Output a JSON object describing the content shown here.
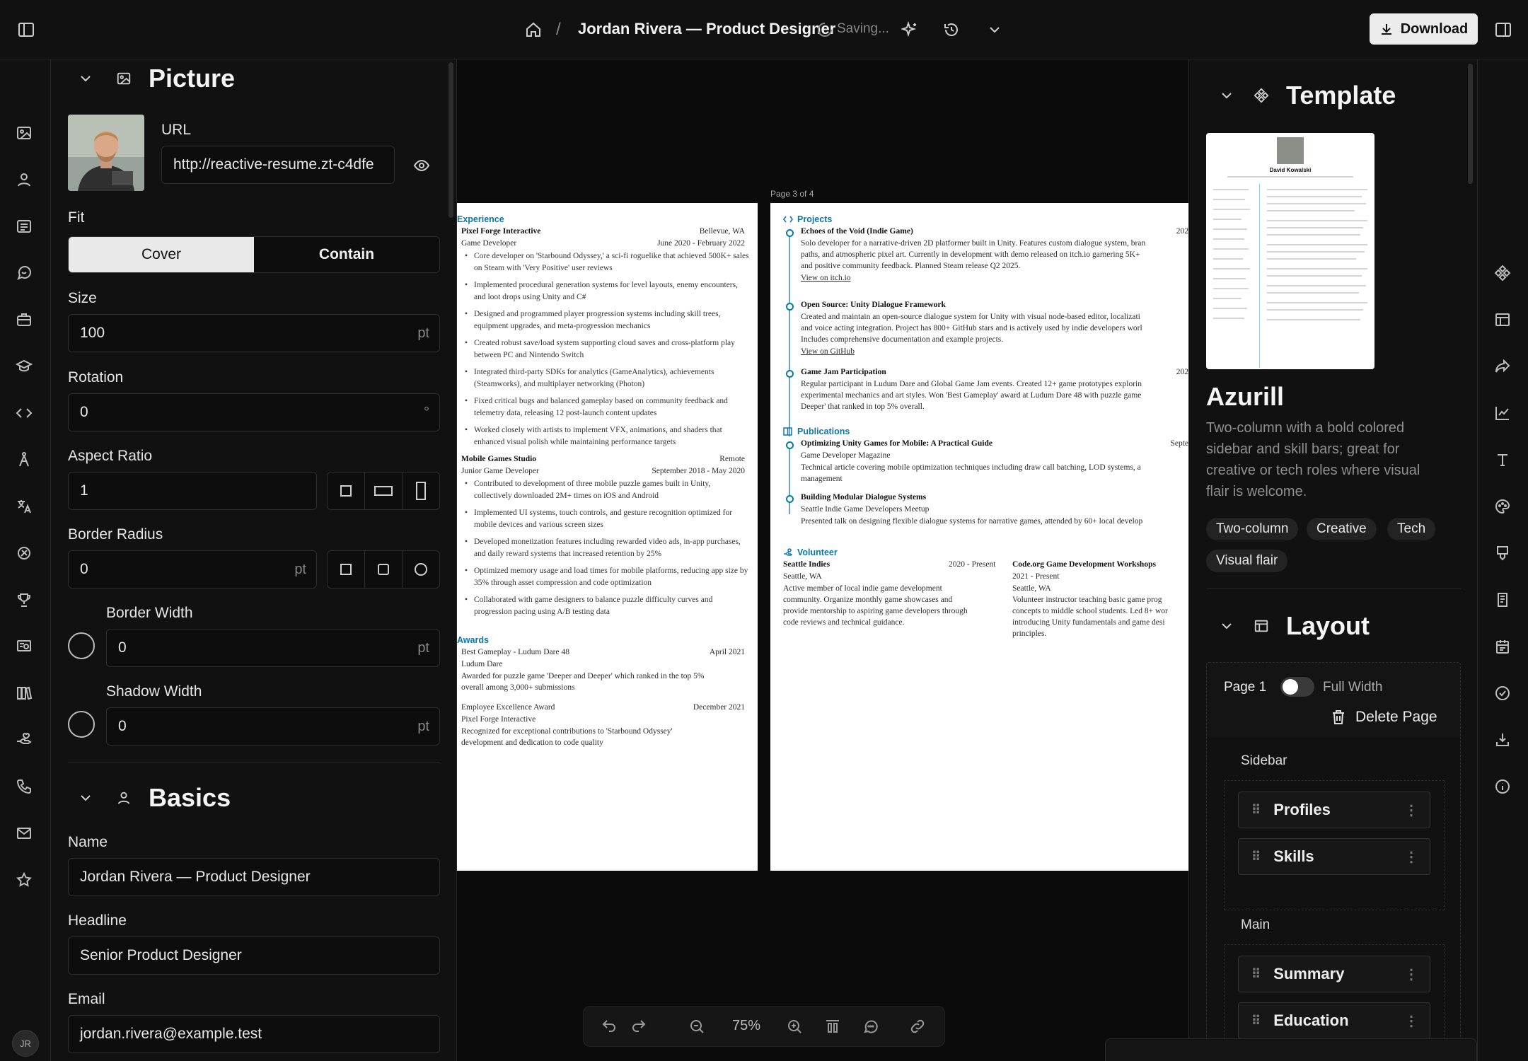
{
  "topbar": {
    "title": "Jordan Rivera — Product Designer",
    "separator": "/",
    "status": "Saving...",
    "download_label": "Download"
  },
  "picture": {
    "heading": "Picture",
    "url_label": "URL",
    "url_value": "http://reactive-resume.zt-c4dfe",
    "fit_label": "Fit",
    "fit_options": [
      "Cover",
      "Contain"
    ],
    "fit_selected": "Cover",
    "size_label": "Size",
    "size_value": "100",
    "size_unit": "pt",
    "rotation_label": "Rotation",
    "rotation_value": "0",
    "rotation_unit": "°",
    "aspect_label": "Aspect Ratio",
    "aspect_value": "1",
    "radius_label": "Border Radius",
    "radius_value": "0",
    "radius_unit": "pt",
    "border_width_label": "Border Width",
    "border_width_value": "0",
    "border_width_unit": "pt",
    "shadow_label": "Shadow Width",
    "shadow_value": "0",
    "shadow_unit": "pt"
  },
  "basics": {
    "heading": "Basics",
    "name_label": "Name",
    "name_value": "Jordan Rivera — Product Designer",
    "headline_label": "Headline",
    "headline_value": "Senior Product Designer",
    "email_label": "Email",
    "email_value": "jordan.rivera@example.test"
  },
  "user": {
    "initials": "JR"
  },
  "page_indicator": "Page 3 of 4",
  "resume_left": {
    "experience_heading": "Experience",
    "job1": {
      "company": "Pixel Forge Interactive",
      "location": "Bellevue, WA",
      "role": "Game Developer",
      "dates": "June 2020 - February 2022",
      "bullets": [
        "Core developer on 'Starbound Odyssey,' a sci-fi roguelike that achieved 500K+ sales on Steam with 'Very Positive' user reviews",
        "Implemented procedural generation systems for level layouts, enemy encounters, and loot drops using Unity and C#",
        "Designed and programmed player progression systems including skill trees, equipment upgrades, and meta-progression mechanics",
        "Created robust save/load system supporting cloud saves and cross-platform play between PC and Nintendo Switch",
        "Integrated third-party SDKs for analytics (GameAnalytics), achievements (Steamworks), and multiplayer networking (Photon)",
        "Fixed critical bugs and balanced gameplay based on community feedback and telemetry data, releasing 12 post-launch content updates",
        "Worked closely with artists to implement VFX, animations, and shaders that enhanced visual polish while maintaining performance targets"
      ]
    },
    "job2": {
      "company": "Mobile Games Studio",
      "location": "Remote",
      "role": "Junior Game Developer",
      "dates": "September 2018 - May 2020",
      "bullets": [
        "Contributed to development of three mobile puzzle games built in Unity, collectively downloaded 2M+ times on iOS and Android",
        "Implemented UI systems, touch controls, and gesture recognition optimized for mobile devices and various screen sizes",
        "Developed monetization features including rewarded video ads, in-app purchases, and daily reward systems that increased retention by 25%",
        "Optimized memory usage and load times for mobile platforms, reducing app size by 35% through asset compression and code optimization",
        "Collaborated with game designers to balance puzzle difficulty curves and progression pacing using A/B testing data"
      ]
    },
    "awards_heading": "Awards",
    "award1": {
      "title": "Best Gameplay - Ludum Dare 48",
      "date": "April 2021",
      "issuer": "Ludum Dare",
      "desc1": "Awarded for puzzle game 'Deeper and Deeper' which ranked in the top 5%",
      "desc2": "overall among 3,000+ submissions"
    },
    "award2": {
      "title": "Employee Excellence Award",
      "date": "December 2021",
      "issuer": "Pixel Forge Interactive",
      "desc1": "Recognized for exceptional contributions to 'Starbound Odyssey'",
      "desc2": "development and dedication to code quality"
    }
  },
  "resume_right": {
    "projects_heading": "Projects",
    "p1": {
      "title": "Echoes of the Void (Indie Game)",
      "date": "202",
      "l1": "Solo developer for a narrative-driven 2D platformer built in Unity. Features custom dialogue system, bran",
      "l2": "paths, and atmospheric pixel art. Currently in development with demo released on itch.io garnering 5K+",
      "l3": "and positive community feedback. Planned Steam release Q2 2025.",
      "link": "View on itch.io"
    },
    "p2": {
      "title": "Open Source: Unity Dialogue Framework",
      "l1": "Created and maintain an open-source dialogue system for Unity with visual node-based editor, localizati",
      "l2": "and voice acting integration. Project has 800+ GitHub stars and is actively used by indie developers worl",
      "l3": "Includes comprehensive documentation and example projects.",
      "link": "View on GitHub"
    },
    "p3": {
      "title": "Game Jam Participation",
      "date": "202",
      "l1": "Regular participant in Ludum Dare and Global Game Jam events. Created 12+ game prototypes explorin",
      "l2": "experimental mechanics and art styles. Won 'Best Gameplay' award at Ludum Dare 48 with puzzle game",
      "l3": "Deeper' that ranked in top 5% overall."
    },
    "publications_heading": "Publications",
    "pub1": {
      "title": "Optimizing Unity Games for Mobile: A Practical Guide",
      "date": "Septe",
      "venue": "Game Developer Magazine",
      "l1": "Technical article covering mobile optimization techniques including draw call batching, LOD systems, a",
      "l2": "management"
    },
    "pub2": {
      "title": "Building Modular Dialogue Systems",
      "venue": "Seattle Indie Game Developers Meetup",
      "l1": "Presented talk on designing flexible dialogue systems for narrative games, attended by 60+ local develop"
    },
    "volunteer_heading": "Volunteer",
    "v1": {
      "org": "Seattle Indies",
      "dates": "2020 - Present",
      "loc": "Seattle, WA",
      "l1": "Active member of local indie game development",
      "l2": "community. Organize monthly game showcases and",
      "l3": "provide mentorship to aspiring game developers through",
      "l4": "code reviews and technical guidance."
    },
    "v2": {
      "org": "Code.org Game Development Workshops",
      "dates": "2021 - Present",
      "loc": "Seattle, WA",
      "l1": "Volunteer instructor teaching basic game prog",
      "l2": "concepts to middle school students. Led 8+ wor",
      "l3": "introducing Unity fundamentals and game desi",
      "l4": "principles."
    }
  },
  "zoom": {
    "level": "75%"
  },
  "template": {
    "heading": "Template",
    "preview_name": "David Kowalski",
    "name": "Azurill",
    "description": "Two-column with a bold colored sidebar and skill bars; great for creative or tech roles where visual flair is welcome.",
    "tags": [
      "Two-column",
      "Creative",
      "Tech",
      "Visual flair"
    ]
  },
  "layout": {
    "heading": "Layout",
    "page_label": "Page 1",
    "full_width_label": "Full Width",
    "full_width_on": false,
    "delete_label": "Delete Page",
    "sidebar_label": "Sidebar",
    "sidebar_items": [
      "Profiles",
      "Skills"
    ],
    "main_label": "Main",
    "main_items": [
      "Summary",
      "Education"
    ]
  },
  "icons": {
    "left_rail": [
      "image-icon",
      "user-icon",
      "summary-icon",
      "profiles-icon",
      "briefcase-icon",
      "graduation-cap-icon",
      "code-icon",
      "skills-icon",
      "languages-icon",
      "interests-icon",
      "trophy-icon",
      "certificate-icon",
      "books-icon",
      "volunteer-icon",
      "phone-icon",
      "mail-icon",
      "star-icon"
    ],
    "right_rail": [
      "template-icon",
      "layout-icon",
      "share-icon",
      "statistics-icon",
      "typography-icon",
      "theme-icon",
      "page-icon",
      "notes-icon",
      "calendar-icon",
      "check-icon",
      "export-icon",
      "info-icon"
    ]
  },
  "colors": {
    "accent": "#0b78a6",
    "panel": "#111111",
    "canvas": "#0b0b0b"
  }
}
